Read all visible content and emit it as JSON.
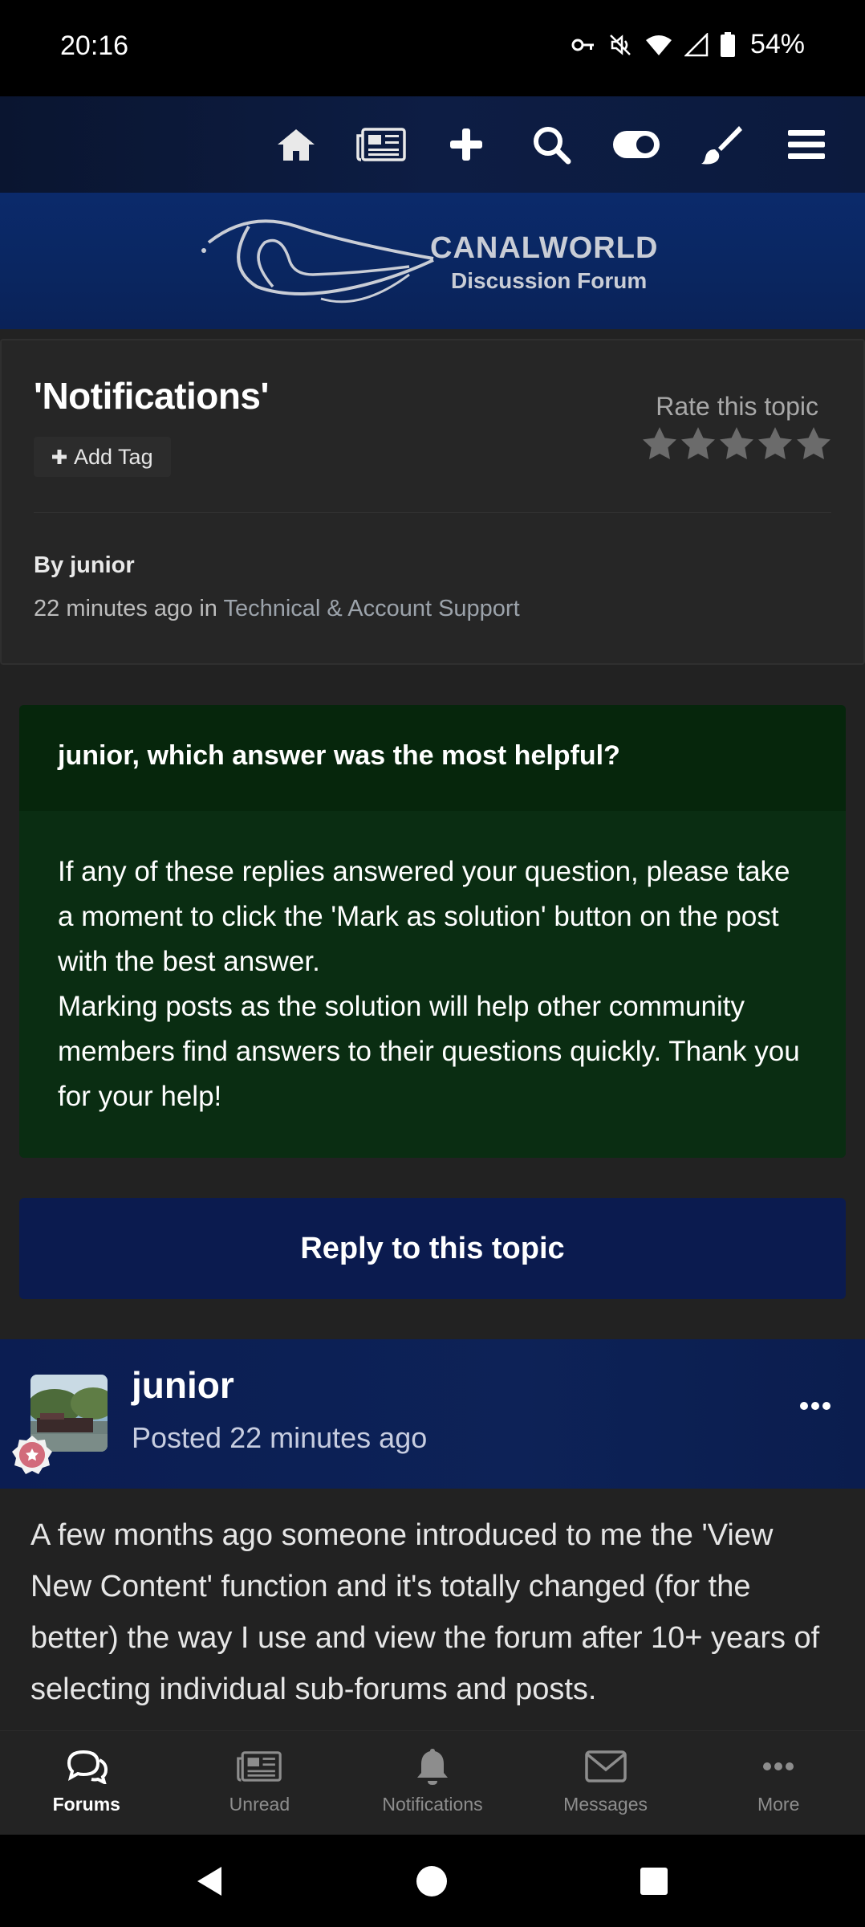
{
  "status_bar": {
    "time": "20:16",
    "battery": "54%",
    "icons": [
      "vpn-key-icon",
      "silent-icon",
      "wifi-icon",
      "signal-icon",
      "battery-icon"
    ]
  },
  "top_nav": {
    "icons": [
      "home-icon",
      "news-icon",
      "plus-icon",
      "search-icon",
      "toggle-icon",
      "brush-icon",
      "menu-icon"
    ]
  },
  "banner": {
    "logo_line1": "CANALWORLD",
    "logo_line2": "Discussion Forum"
  },
  "topic": {
    "title": "'Notifications'",
    "add_tag": "Add Tag",
    "rate_label": "Rate this topic",
    "rating": 0,
    "rating_max": 5,
    "by_line": "By junior",
    "time_ago": "22 minutes ago in ",
    "category": "Technical & Account Support"
  },
  "solution_box": {
    "heading": "junior, which answer was the most helpful?",
    "para1": "If any of these replies answered your question, please take a moment to click the 'Mark as solution' button on the post with the best answer.",
    "para2": "Marking posts as the solution will help other community members find answers to their questions quickly. Thank you for your help!"
  },
  "reply_button": "Reply to this topic",
  "post": {
    "author": "junior",
    "posted": "Posted 22 minutes ago",
    "body": "A few months ago someone introduced to me the 'View New Content' function and it's totally changed (for the better) the way I use and view the forum after 10+ years of selecting individual sub-forums and posts."
  },
  "tabs": [
    {
      "label": "Forums",
      "icon": "forums-icon",
      "active": true
    },
    {
      "label": "Unread",
      "icon": "unread-icon",
      "active": false
    },
    {
      "label": "Notifications",
      "icon": "bell-icon",
      "active": false
    },
    {
      "label": "Messages",
      "icon": "envelope-icon",
      "active": false
    },
    {
      "label": "More",
      "icon": "more-icon",
      "active": false
    }
  ],
  "colors": {
    "nav_bg": "#0c1a3d",
    "solution_bg": "#0a2d12",
    "reply_bg": "#0b1b4f",
    "page_bg": "#222222"
  }
}
